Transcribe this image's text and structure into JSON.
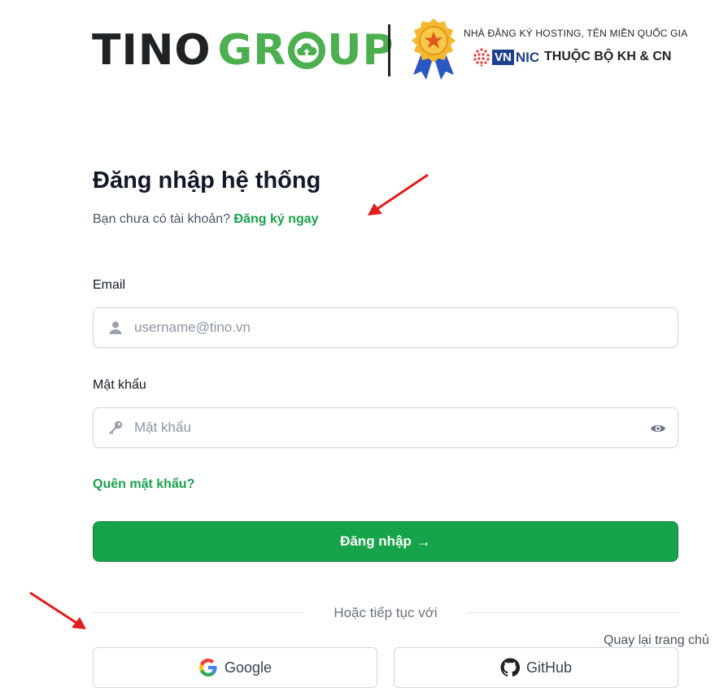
{
  "brand": {
    "name_dark": "TINO",
    "name_green_g": "GR",
    "name_green_rest": "UP",
    "certification_line": "NHÀ ĐĂNG KÝ HOSTING, TÊN MIỀN QUỐC GIA",
    "vnnic_vn": "VN",
    "vnnic_nic": "NIC",
    "ministry": "THUỘC BỘ KH & CN",
    "colors": {
      "dark": "#1f2326",
      "green": "#4caf50",
      "vnnic_blue": "#1e3f8a"
    }
  },
  "login": {
    "title": "Đăng nhập hệ thống",
    "no_account_text": "Bạn chưa có tài khoản?",
    "register_link": "Đăng ký ngay",
    "email_label": "Email",
    "email_placeholder": "username@tino.vn",
    "email_value": "",
    "password_label": "Mật khẩu",
    "password_placeholder": "Mật khẩu",
    "password_value": "",
    "forgot_link": "Quên mật khẩu?",
    "submit_label": "Đăng nhập",
    "submit_arrow": "→",
    "divider_text": "Hoặc tiếp tục với",
    "back_home": "Quay lại trang chủ",
    "social": [
      {
        "label": "Google",
        "icon": "google-icon"
      },
      {
        "label": "GitHub",
        "icon": "github-icon"
      }
    ],
    "colors": {
      "primary": "#16a34a",
      "text": "#111827",
      "muted": "#4b5563",
      "annotation": "#e11d1d"
    }
  }
}
